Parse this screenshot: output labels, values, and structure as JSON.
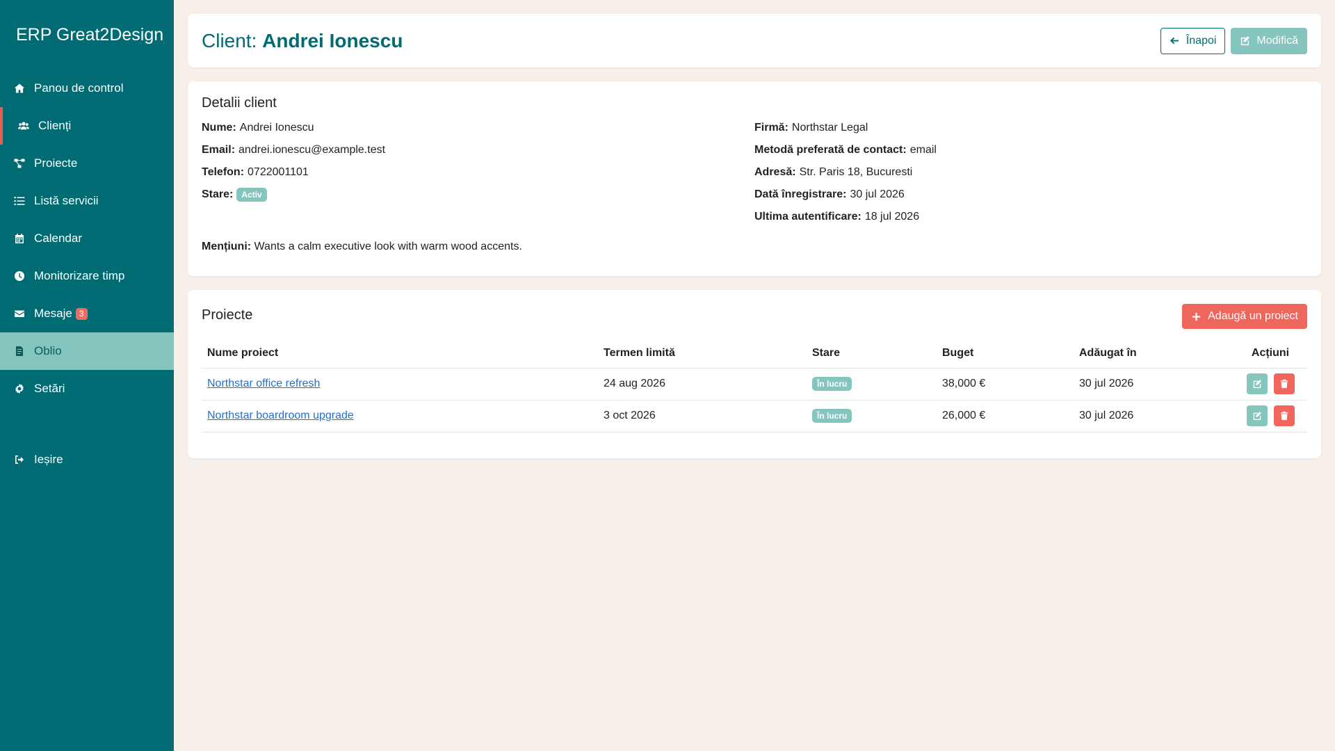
{
  "app": {
    "brand": "ERP Great2Design"
  },
  "sidebar": {
    "items": [
      {
        "label": "Panou de control",
        "icon": "home-icon"
      },
      {
        "label": "Clienți",
        "icon": "users-icon"
      },
      {
        "label": "Proiecte",
        "icon": "project-diagram-icon"
      },
      {
        "label": "Listă servicii",
        "icon": "list-icon"
      },
      {
        "label": "Calendar",
        "icon": "calendar-icon"
      },
      {
        "label": "Monitorizare timp",
        "icon": "clock-icon"
      },
      {
        "label": "Mesaje",
        "icon": "envelope-icon",
        "badge": "3"
      },
      {
        "label": "Oblio",
        "icon": "invoice-icon"
      },
      {
        "label": "Setări",
        "icon": "gear-icon"
      }
    ],
    "logout": {
      "label": "Ieșire",
      "icon": "sign-out-icon"
    }
  },
  "header": {
    "title_prefix": "Client: ",
    "title_name": "Andrei Ionescu",
    "back_label": "Înapoi",
    "edit_label": "Modifică"
  },
  "details": {
    "title": "Detalii client",
    "left": [
      {
        "label": "Nume:",
        "value": "Andrei Ionescu"
      },
      {
        "label": "Email:",
        "value": "andrei.ionescu@example.test"
      },
      {
        "label": "Telefon:",
        "value": "0722001101"
      },
      {
        "label": "Stare:",
        "value": "Activ"
      }
    ],
    "right": [
      {
        "label": "Firmă:",
        "value": "Northstar Legal"
      },
      {
        "label": "Metodă preferată de contact:",
        "value": "email"
      },
      {
        "label": "Adresă:",
        "value": "Str. Paris 18, Bucuresti"
      },
      {
        "label": "Dată înregistrare:",
        "value": "30 jul 2026"
      },
      {
        "label": "Ultima autentificare:",
        "value": "18 jul 2026"
      }
    ],
    "mentions_label": "Mențiuni:",
    "mentions_value": "Wants a calm executive look with warm wood accents."
  },
  "projects": {
    "title": "Proiecte",
    "add_label": "Adaugă un proiect",
    "columns": [
      "Nume proiect",
      "Termen limită",
      "Stare",
      "Buget",
      "Adăugat în",
      "Acțiuni"
    ],
    "rows": [
      {
        "name": "Northstar office refresh",
        "deadline": "24 aug 2026",
        "status": "În lucru",
        "budget": "38,000 €",
        "added": "30 jul 2026"
      },
      {
        "name": "Northstar boardroom upgrade",
        "deadline": "3 oct 2026",
        "status": "În lucru",
        "budget": "26,000 €",
        "added": "30 jul 2026"
      }
    ]
  },
  "colors": {
    "sidebar": "#006b73",
    "accent_teal": "#84c5bd",
    "accent_red": "#f0665c",
    "background": "#f7efe9"
  }
}
